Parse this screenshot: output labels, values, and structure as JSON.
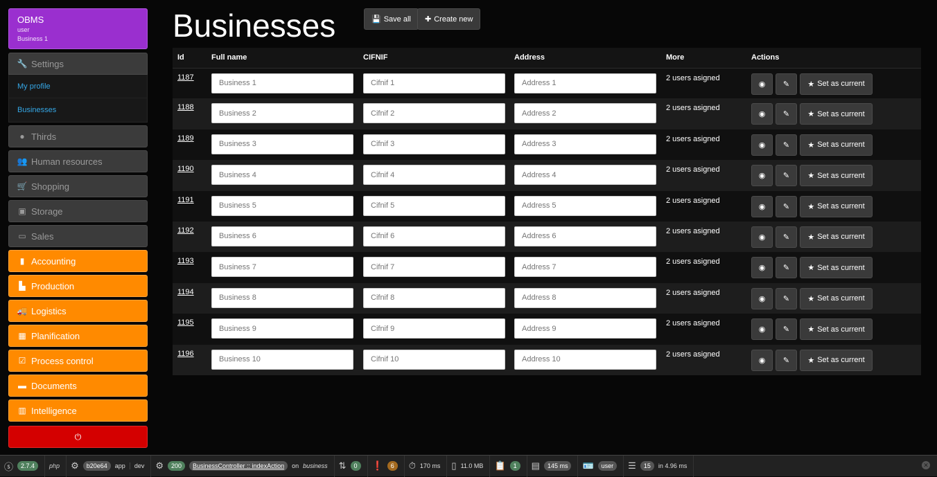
{
  "sidebar": {
    "brand": {
      "app": "OBMS",
      "user": "user",
      "business": "Business 1"
    },
    "settings": {
      "label": "Settings",
      "icon": "wrench-icon"
    },
    "sub_items": [
      {
        "label": "My profile"
      },
      {
        "label": "Businesses"
      }
    ],
    "gray_items": [
      {
        "label": "Thirds",
        "icon": "globe-icon"
      },
      {
        "label": "Human resources",
        "icon": "users-icon"
      },
      {
        "label": "Shopping",
        "icon": "cart-icon"
      },
      {
        "label": "Storage",
        "icon": "cubes-icon"
      },
      {
        "label": "Sales",
        "icon": "money-icon"
      }
    ],
    "orange_items": [
      {
        "label": "Accounting",
        "icon": "book-icon"
      },
      {
        "label": "Production",
        "icon": "factory-icon"
      },
      {
        "label": "Logistics",
        "icon": "truck-icon"
      },
      {
        "label": "Planification",
        "icon": "calendar-icon"
      },
      {
        "label": "Process control",
        "icon": "checkbox-icon"
      },
      {
        "label": "Documents",
        "icon": "folder-icon"
      },
      {
        "label": "Intelligence",
        "icon": "bar-chart-icon"
      }
    ],
    "logout_icon": "power-icon"
  },
  "page": {
    "title": "Businesses",
    "save_all": "Save all",
    "create_new": "Create new"
  },
  "table": {
    "headers": {
      "id": "Id",
      "full_name": "Full name",
      "cifnif": "CIFNIF",
      "address": "Address",
      "more": "More",
      "actions": "Actions"
    },
    "set_current_label": "Set as current",
    "rows": [
      {
        "id": "1187",
        "name": "Business 1",
        "cifnif": "Cifnif 1",
        "address": "Address 1",
        "more": "2 users asigned"
      },
      {
        "id": "1188",
        "name": "Business 2",
        "cifnif": "Cifnif 2",
        "address": "Address 2",
        "more": "2 users asigned"
      },
      {
        "id": "1189",
        "name": "Business 3",
        "cifnif": "Cifnif 3",
        "address": "Address 3",
        "more": "2 users asigned"
      },
      {
        "id": "1190",
        "name": "Business 4",
        "cifnif": "Cifnif 4",
        "address": "Address 4",
        "more": "2 users asigned"
      },
      {
        "id": "1191",
        "name": "Business 5",
        "cifnif": "Cifnif 5",
        "address": "Address 5",
        "more": "2 users asigned"
      },
      {
        "id": "1192",
        "name": "Business 6",
        "cifnif": "Cifnif 6",
        "address": "Address 6",
        "more": "2 users asigned"
      },
      {
        "id": "1193",
        "name": "Business 7",
        "cifnif": "Cifnif 7",
        "address": "Address 7",
        "more": "2 users asigned"
      },
      {
        "id": "1194",
        "name": "Business 8",
        "cifnif": "Cifnif 8",
        "address": "Address 8",
        "more": "2 users asigned"
      },
      {
        "id": "1195",
        "name": "Business 9",
        "cifnif": "Cifnif 9",
        "address": "Address 9",
        "more": "2 users asigned"
      },
      {
        "id": "1196",
        "name": "Business 10",
        "cifnif": "Cifnif 10",
        "address": "Address 10",
        "more": "2 users asigned"
      }
    ]
  },
  "toolbar": {
    "symfony_version": "2.7.4",
    "php_label": "php",
    "commit": "b20e64",
    "app": "app",
    "env": "dev",
    "status": "200",
    "controller": "BusinessController :: indexAction",
    "route_prefix": "on",
    "route": "business",
    "ajax_count": "0",
    "warnings": "6",
    "time": "170 ms",
    "memory": "11.0 MB",
    "forms": "1",
    "render_time": "145 ms",
    "user": "user",
    "queries": "15",
    "query_time": "in 4.96 ms"
  },
  "colors": {
    "brand": "#9a2fcf",
    "orange": "#ff8a00",
    "logout": "#d40000",
    "link": "#35a7e6"
  }
}
